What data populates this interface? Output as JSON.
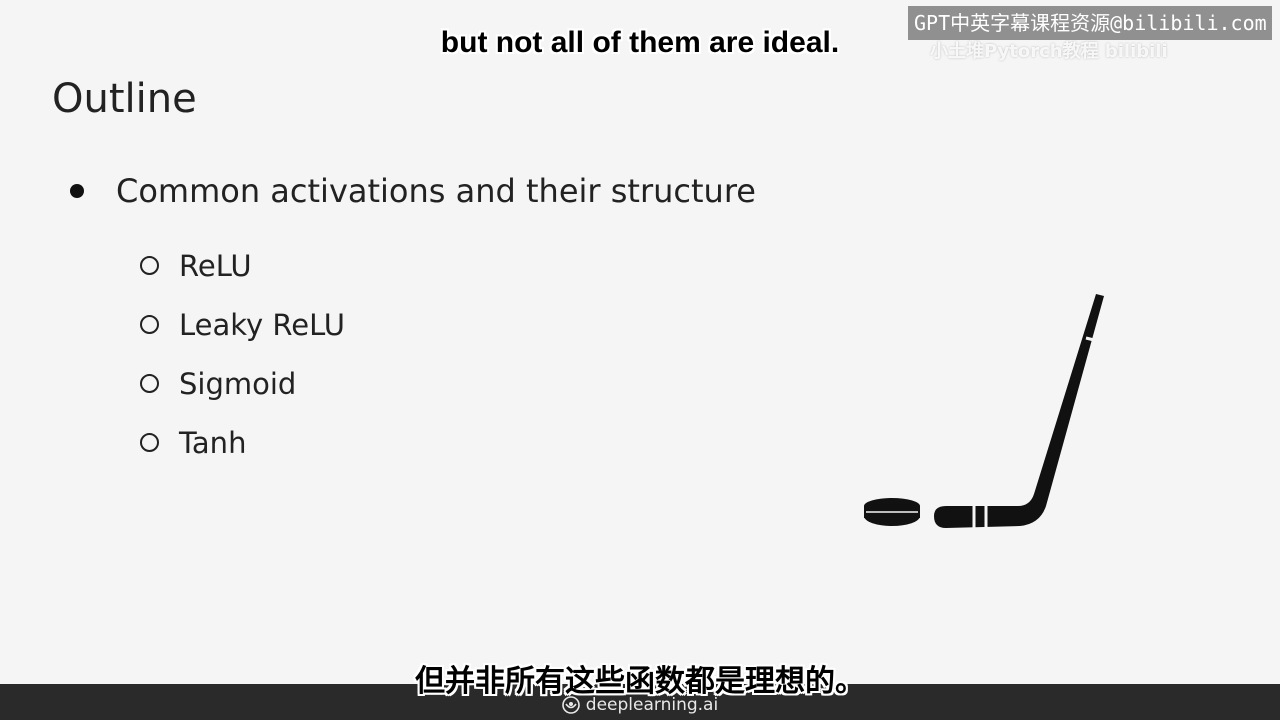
{
  "watermark": {
    "text": "GPT中英字幕课程资源@bilibili.com",
    "sub": "小土堆Pytorch教程  bilibili"
  },
  "subtitles": {
    "english": "but not all of them are ideal.",
    "chinese": "但并非所有这些函数都是理想的。"
  },
  "slide": {
    "title": "Outline",
    "main_bullet": "Common activations and their structure",
    "sub_bullets": [
      "ReLU",
      "Leaky ReLU",
      "Sigmoid",
      "Tanh"
    ],
    "illustration_icon": "hockey-stick-and-puck-icon"
  },
  "footer": {
    "brand": "deeplearning.ai",
    "logo_icon": "deeplearning-logo-icon"
  },
  "colors": {
    "background": "#f5f5f5",
    "text": "#222222",
    "footer_bg": "#2a2a2a"
  }
}
